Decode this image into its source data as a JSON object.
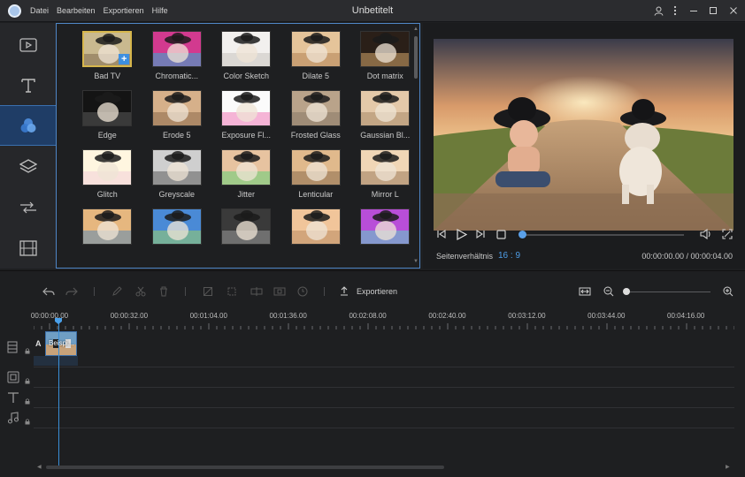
{
  "window": {
    "title": "Unbetitelt",
    "menu": [
      "Datei",
      "Bearbeiten",
      "Exportieren",
      "Hilfe"
    ]
  },
  "rail": {
    "items": [
      {
        "name": "media",
        "icon": "media-icon"
      },
      {
        "name": "text",
        "icon": "text-icon"
      },
      {
        "name": "filters",
        "icon": "filters-icon",
        "active": true
      },
      {
        "name": "overlays",
        "icon": "overlay-icon"
      },
      {
        "name": "transitions",
        "icon": "transition-icon"
      },
      {
        "name": "elements",
        "icon": "film-icon"
      }
    ]
  },
  "effects": {
    "items": [
      {
        "label": "Bad TV",
        "selected": true
      },
      {
        "label": "Chromatic..."
      },
      {
        "label": "Color Sketch"
      },
      {
        "label": "Dilate 5"
      },
      {
        "label": "Dot matrix"
      },
      {
        "label": "Edge"
      },
      {
        "label": "Erode 5"
      },
      {
        "label": "Exposure Fl..."
      },
      {
        "label": "Frosted Glass"
      },
      {
        "label": "Gaussian Bl..."
      },
      {
        "label": "Glitch"
      },
      {
        "label": "Greyscale"
      },
      {
        "label": "Jitter"
      },
      {
        "label": "Lenticular"
      },
      {
        "label": "Mirror L"
      },
      {
        "label": ""
      },
      {
        "label": ""
      },
      {
        "label": ""
      },
      {
        "label": ""
      },
      {
        "label": ""
      }
    ],
    "add_badge": "+"
  },
  "preview": {
    "ratio_label": "Seitenverhältnis",
    "ratio_value": "16 : 9",
    "timecode": "00:00:00.00 / 00:00:04.00",
    "progress": 0.0
  },
  "toolbar": {
    "export_label": "Exportieren"
  },
  "timeline": {
    "ruler": [
      "00:00:00.00",
      "00:00:32.00",
      "00:01:04.00",
      "00:01:36.00",
      "00:02:08.00",
      "00:02:40.00",
      "00:03:12.00",
      "00:03:44.00",
      "00:04:16.00"
    ],
    "track_a_label": "A",
    "clip_label": "Beispi..."
  },
  "colors": {
    "accent": "#4e9ee8",
    "panel_border": "#4f86c6",
    "rail_active": "#1f3d66"
  }
}
